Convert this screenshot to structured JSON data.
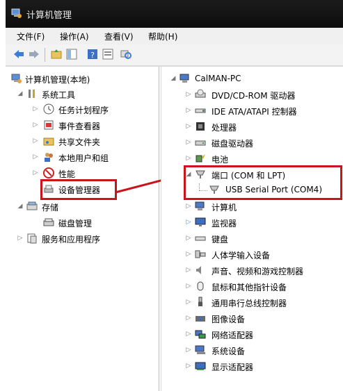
{
  "window": {
    "title": "计算机管理"
  },
  "menu": [
    "文件(F)",
    "操作(A)",
    "查看(V)",
    "帮助(H)"
  ],
  "toolbar": {
    "icons": [
      "back-arrow-icon",
      "forward-arrow-icon",
      "up-folder-icon",
      "show-hide-tree-icon",
      "help-icon",
      "properties-icon",
      "scan-hardware-icon"
    ]
  },
  "left_tree": [
    {
      "label": "计算机管理(本地)",
      "expanded": true,
      "icon": "computer-management-icon"
    },
    {
      "label": "系统工具",
      "expanded": true,
      "icon": "tools-icon"
    },
    {
      "label": "任务计划程序",
      "icon": "clock-icon"
    },
    {
      "label": "事件查看器",
      "icon": "event-viewer-icon"
    },
    {
      "label": "共享文件夹",
      "icon": "shared-folder-icon"
    },
    {
      "label": "本地用户和组",
      "icon": "users-icon"
    },
    {
      "label": "性能",
      "icon": "performance-icon"
    },
    {
      "label": "设备管理器",
      "icon": "device-manager-icon",
      "highlighted": true
    },
    {
      "label": "存储",
      "expanded": true,
      "icon": "storage-icon"
    },
    {
      "label": "磁盘管理",
      "icon": "disk-management-icon"
    },
    {
      "label": "服务和应用程序",
      "icon": "services-icon"
    }
  ],
  "right_tree": {
    "root": "CalMAN-PC",
    "categories": [
      {
        "label": "DVD/CD-ROM 驱动器",
        "icon": "dvd-drive-icon"
      },
      {
        "label": "IDE ATA/ATAPI 控制器",
        "icon": "ide-controller-icon"
      },
      {
        "label": "处理器",
        "icon": "processor-icon"
      },
      {
        "label": "磁盘驱动器",
        "icon": "disk-drive-icon"
      },
      {
        "label": "电池",
        "icon": "battery-icon"
      },
      {
        "label": "端口 (COM 和 LPT)",
        "icon": "port-icon",
        "expanded": true
      },
      {
        "label": "USB Serial Port (COM4)",
        "icon": "port-icon",
        "child": true
      },
      {
        "label": "计算机",
        "icon": "computer-icon"
      },
      {
        "label": "监视器",
        "icon": "monitor-icon"
      },
      {
        "label": "键盘",
        "icon": "keyboard-icon"
      },
      {
        "label": "人体学输入设备",
        "icon": "hid-icon"
      },
      {
        "label": "声音、视频和游戏控制器",
        "icon": "sound-icon"
      },
      {
        "label": "鼠标和其他指针设备",
        "icon": "mouse-icon"
      },
      {
        "label": "通用串行总线控制器",
        "icon": "usb-icon"
      },
      {
        "label": "图像设备",
        "icon": "imaging-icon"
      },
      {
        "label": "网络适配器",
        "icon": "network-icon"
      },
      {
        "label": "系统设备",
        "icon": "system-device-icon"
      },
      {
        "label": "显示适配器",
        "icon": "display-adapter-icon"
      }
    ]
  },
  "colors": {
    "highlight": "#c9141c",
    "titlebar": "#141414"
  }
}
